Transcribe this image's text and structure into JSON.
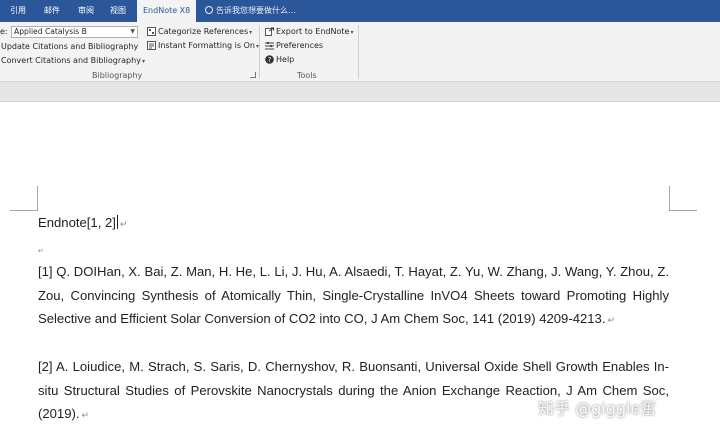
{
  "tabs": [
    {
      "label": "引用"
    },
    {
      "label": "邮件"
    },
    {
      "label": "审阅"
    },
    {
      "label": "视图"
    },
    {
      "label": "EndNote X8"
    }
  ],
  "tell_me": "告诉我您想要做什么...",
  "ribbon": {
    "style_prefix": "e:",
    "style_value": "Applied Catalysis B",
    "update_citations": "Update Citations and Bibliography",
    "convert_citations": "Convert Citations and Bibliography",
    "categorize_references": "Categorize References",
    "instant_formatting": "Instant Formatting is On",
    "bibliography_group": "Bibliography",
    "export_to_endnote": "Export to EndNote",
    "preferences": "Preferences",
    "help": "Help",
    "tools_group": "Tools"
  },
  "document": {
    "citation_line": "Endnote[1, 2]",
    "pilcrow": "↵",
    "references": [
      "[1] Q. DOIHan, X. Bai, Z. Man, H. He, L. Li, J. Hu, A. Alsaedi, T. Hayat, Z. Yu, W. Zhang, J. Wang, Y. Zhou, Z. Zou, Convincing Synthesis of Atomically Thin, Single-Crystalline InVO4 Sheets toward Promoting Highly Selective and Efficient Solar Conversion of CO2 into CO, J Am Chem Soc, 141 (2019) 4209-4213.",
      "[2] A. Loiudice, M. Strach, S. Saris, D. Chernyshov, R. Buonsanti, Universal Oxide Shell Growth Enables In-situ Structural Studies of Perovskite Nanocrystals during the Anion Exchange Reaction, J Am Chem Soc, (2019)."
    ]
  },
  "watermark": "知乎 @giggle奮",
  "colors": {
    "accent": "#2b579a",
    "ribbon": "#f3f3f3"
  }
}
